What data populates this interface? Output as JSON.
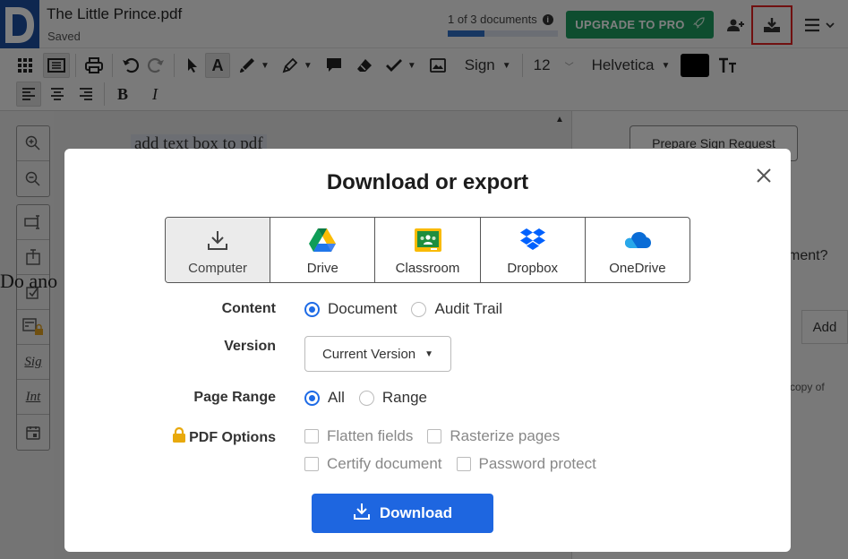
{
  "header": {
    "doc_title": "The Little Prince.pdf",
    "doc_status": "Saved",
    "doc_count": "1 of 3 documents",
    "doc_progress_fraction": 0.33,
    "upgrade_label": "UPGRADE TO PRO"
  },
  "toolbar": {
    "sign_label": "Sign",
    "font_size": "12",
    "font_family": "Helvetica",
    "color": "#000000"
  },
  "document": {
    "text_line1": "add text box to pdf",
    "text_line2": "Do ano"
  },
  "right_panel": {
    "prepare_label": "Prepare Sign Request",
    "question_fragment": "ment?",
    "add_label": "Add",
    "copy_fragment": "copy of"
  },
  "modal": {
    "title": "Download or export",
    "destinations": [
      {
        "label": "Computer",
        "icon": "download-tray-icon",
        "selected": true
      },
      {
        "label": "Drive",
        "icon": "google-drive-icon",
        "selected": false
      },
      {
        "label": "Classroom",
        "icon": "google-classroom-icon",
        "selected": false
      },
      {
        "label": "Dropbox",
        "icon": "dropbox-icon",
        "selected": false
      },
      {
        "label": "OneDrive",
        "icon": "onedrive-icon",
        "selected": false
      }
    ],
    "content": {
      "label": "Content",
      "options": [
        "Document",
        "Audit Trail"
      ],
      "selected": "Document"
    },
    "version": {
      "label": "Version",
      "value": "Current Version"
    },
    "page_range": {
      "label": "Page Range",
      "options": [
        "All",
        "Range"
      ],
      "selected": "All"
    },
    "pdf_options": {
      "label": "PDF Options",
      "checkboxes": [
        "Flatten fields",
        "Rasterize pages",
        "Certify document",
        "Password protect"
      ]
    },
    "download_label": "Download"
  },
  "colors": {
    "brand_blue": "#1d4fa0",
    "upgrade_green": "#1c9a5e",
    "primary_button": "#1e66e0",
    "highlight_red": "#e02020"
  }
}
